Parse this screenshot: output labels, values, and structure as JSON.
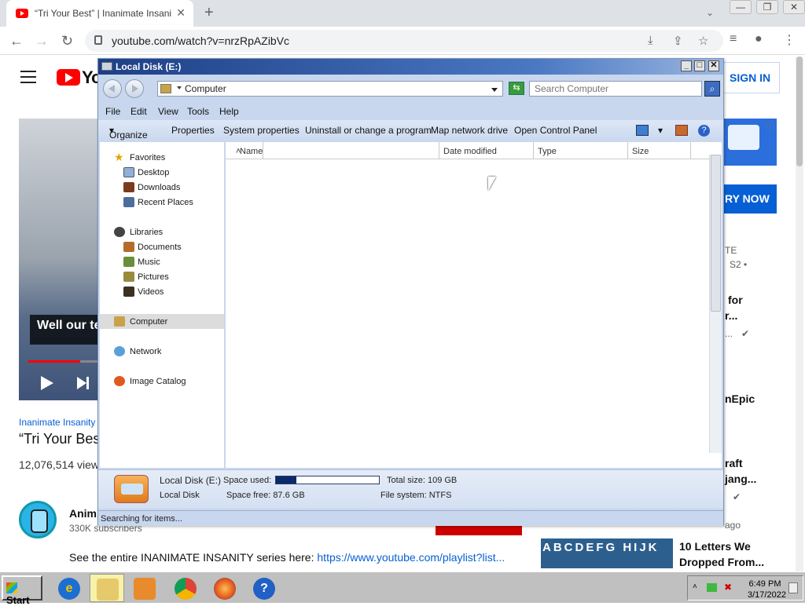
{
  "browser": {
    "tab_title": "“Tri Your Best” | Inanimate Insanity",
    "url": "youtube.com/watch?v=nrzRpAZibVc"
  },
  "youtube": {
    "logo_text": "Yo",
    "sign_in": "SIGN IN",
    "video_caption": "Well our te",
    "channel_link": "Inanimate Insanity",
    "video_title": "“Tri Your Bes",
    "views": "12,076,514 view",
    "channel_name": "Anim",
    "subscribers": "330K subscribers",
    "description": "See the entire INANIMATE INSANITY series here: ",
    "description_link": "https://www.youtube.com/playlist?list...",
    "ad_button": "RY NOW",
    "side": {
      "s1": "TE",
      "s2": "S2 •",
      "s3": "for",
      "s4": "r...",
      "s5": "...",
      "s6": "nEpic",
      "s7": "raft",
      "s8": "jang...",
      "s9": "ago",
      "s10": "10 Letters We",
      "s11": "Dropped From...",
      "thumb_text": "ABCDEFG HIJK"
    }
  },
  "explorer": {
    "title": "Local Disk (E:)",
    "address": "Computer",
    "search_placeholder": "Search Computer",
    "menu": [
      "File",
      "Edit",
      "View",
      "Tools",
      "Help"
    ],
    "toolbar": [
      "Organize",
      "Properties",
      "System properties",
      "Uninstall or change a program",
      "Map network drive",
      "Open Control Panel"
    ],
    "nav": {
      "favorites": "Favorites",
      "desktop": "Desktop",
      "downloads": "Downloads",
      "recent": "Recent Places",
      "libraries": "Libraries",
      "documents": "Documents",
      "music": "Music",
      "pictures": "Pictures",
      "videos": "Videos",
      "computer": "Computer",
      "network": "Network",
      "image_catalog": "Image Catalog"
    },
    "columns": [
      "Name",
      "Date modified",
      "Type",
      "Size"
    ],
    "details": {
      "drive_name": "Local Disk (E:)",
      "drive_type": "Local Disk",
      "space_used_label": "Space used:",
      "space_used_fraction": 0.2,
      "space_free": "Space free: 87.6 GB",
      "total_size": "Total size: 109 GB",
      "file_system": "File system: NTFS"
    },
    "status": "Searching for items..."
  },
  "taskbar": {
    "start": "Start",
    "time": "6:49 PM",
    "date": "3/17/2022"
  }
}
